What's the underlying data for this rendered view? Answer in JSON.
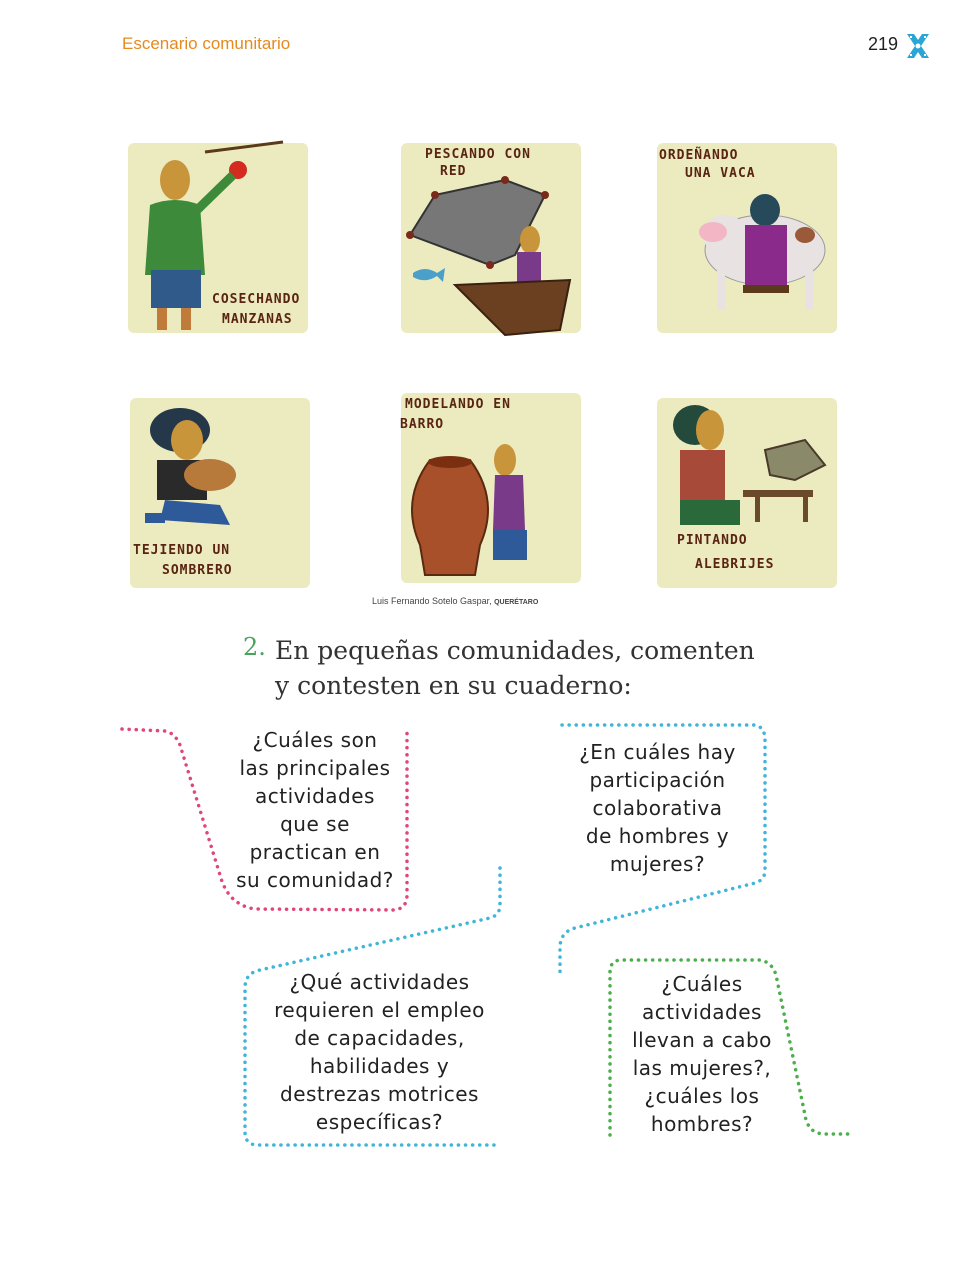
{
  "header": {
    "title": "Escenario comunitario",
    "page_number": "219"
  },
  "illustrations": [
    {
      "caption_line1": "COSECHANDO",
      "caption_line2": "MANZANAS"
    },
    {
      "caption_line1": "PESCANDO CON",
      "caption_line2": "RED"
    },
    {
      "caption_line1": "ORDEÑANDO",
      "caption_line2": "UNA VACA"
    },
    {
      "caption_line1": "TEJIENDO UN",
      "caption_line2": "SOMBRERO"
    },
    {
      "caption_line1": "MODELANDO EN",
      "caption_line2": "BARRO"
    },
    {
      "caption_line1": "PINTANDO",
      "caption_line2": "ALEBRIJES"
    }
  ],
  "credit": {
    "author": "Luis Fernando Sotelo Gaspar, ",
    "place": "QUERÉTARO"
  },
  "activity": {
    "number": "2.",
    "line1": "En pequeñas comunidades, comenten",
    "line2": "y contesten en su cuaderno:"
  },
  "questions": [
    {
      "lines": [
        "¿Cuáles son",
        "las principales",
        "actividades",
        "que se",
        "practican en",
        "su comunidad?"
      ],
      "color": "#e0457b"
    },
    {
      "lines": [
        "¿En cuáles hay",
        "participación",
        "colaborativa",
        "de hombres y",
        "mujeres?"
      ],
      "color": "#3fb5d8"
    },
    {
      "lines": [
        "¿Qué actividades",
        "requieren el empleo",
        "de capacidades,",
        "habilidades y",
        "destrezas motrices",
        "específicas?"
      ],
      "color": "#3fb5d8"
    },
    {
      "lines": [
        "¿Cuáles",
        "actividades",
        "llevan a cabo",
        "las mujeres?,",
        "¿cuáles los",
        "hombres?"
      ],
      "color": "#4cae4c"
    }
  ],
  "colors": {
    "header_orange": "#e58a1f",
    "number_green": "#4aa35a",
    "panel_bg": "#ecebc0",
    "logo_blue": "#2aa6d6"
  }
}
